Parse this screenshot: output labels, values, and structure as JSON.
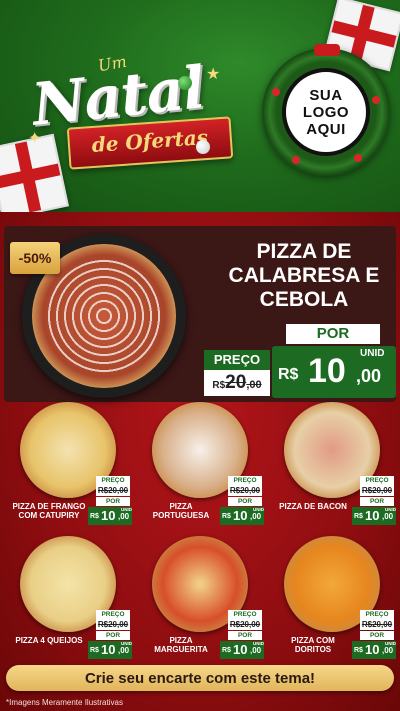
{
  "header": {
    "title_small": "Um",
    "title_big": "Natal",
    "title_ribbon": "de Ofertas",
    "logo_lines": [
      "SUA",
      "LOGO",
      "AQUI"
    ]
  },
  "hero": {
    "discount": "-50%",
    "name_lines": [
      "PIZZA DE",
      "CALABRESA E",
      "CEBOLA"
    ],
    "preco_label": "PREÇO",
    "old_price": {
      "currency": "R$",
      "int": "20",
      "cents": ",00"
    },
    "por_label": "POR",
    "new_price": {
      "currency": "R$",
      "int": "10",
      "cents": ",00",
      "unit": "UNID"
    }
  },
  "products": [
    {
      "name_lines": [
        "PIZZA DE FRANGO",
        "COM CATUPIRY"
      ],
      "preco_label": "PREÇO",
      "old_price": "R$20,00",
      "por_label": "POR",
      "currency": "R$",
      "int": "10",
      "cents": ",00",
      "unit": "UNID",
      "pizza_color": "#e8c46a",
      "topping": "#f3e2b0"
    },
    {
      "name_lines": [
        "PIZZA",
        "PORTUGUESA"
      ],
      "preco_label": "PREÇO",
      "old_price": "R$20,00",
      "por_label": "POR",
      "currency": "R$",
      "int": "10",
      "cents": ",00",
      "unit": "UNID",
      "pizza_color": "#d9b08a",
      "topping": "#f7f0ea"
    },
    {
      "name_lines": [
        "PIZZA DE BACON"
      ],
      "preco_label": "PREÇO",
      "old_price": "R$20,00",
      "por_label": "POR",
      "currency": "R$",
      "int": "10",
      "cents": ",00",
      "unit": "UNID",
      "pizza_color": "#e7cfa6",
      "topping": "#e29a86"
    },
    {
      "name_lines": [
        "PIZZA 4 QUEIJOS"
      ],
      "preco_label": "PREÇO",
      "old_price": "R$20,00",
      "por_label": "POR",
      "currency": "R$",
      "int": "10",
      "cents": ",00",
      "unit": "UNID",
      "pizza_color": "#e9cf86",
      "topping": "#f4e4a8"
    },
    {
      "name_lines": [
        "PIZZA",
        "MARGUERITA"
      ],
      "preco_label": "PREÇO",
      "old_price": "R$20,00",
      "por_label": "POR",
      "currency": "R$",
      "int": "10",
      "cents": ",00",
      "unit": "UNID",
      "pizza_color": "#d84f2a",
      "topping": "#f2d48a"
    },
    {
      "name_lines": [
        "PIZZA COM",
        "DORITOS"
      ],
      "preco_label": "PREÇO",
      "old_price": "R$20,00",
      "por_label": "POR",
      "currency": "R$",
      "int": "10",
      "cents": ",00",
      "unit": "UNID",
      "pizza_color": "#e6861e",
      "topping": "#f2a83a"
    }
  ],
  "cta": "Crie seu encarte com este tema!",
  "disclaimer": "*Imagens Meramente Ilustrativas",
  "colors": {
    "green": "#1d6b22",
    "red": "#8e0d10",
    "gold": "#f6d789"
  }
}
